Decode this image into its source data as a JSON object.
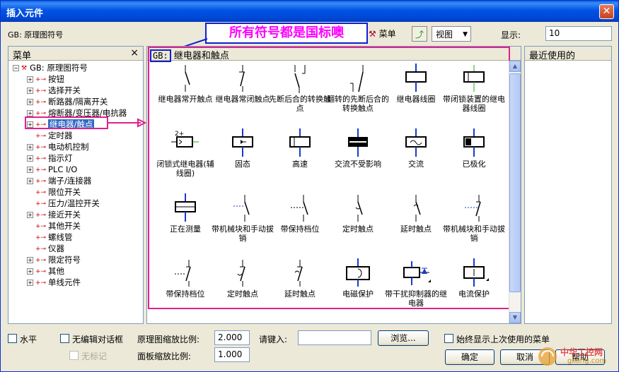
{
  "window": {
    "title": "插入元件",
    "close": "✕"
  },
  "top": {
    "library_label": "GB: 原理图符号",
    "annotation": "所有符号都是国标噢",
    "menu_button": "菜单",
    "view_button": "视图",
    "display_label": "显示:",
    "display_value": "10"
  },
  "left_panel": {
    "header": "菜单",
    "close": "×",
    "root": "GB: 原理图符号",
    "items": [
      {
        "label": "按钮",
        "expander": "+"
      },
      {
        "label": "选择开关",
        "expander": "+"
      },
      {
        "label": "断路器/隔离开关",
        "expander": "+"
      },
      {
        "label": "熔断器/变压器/电抗器",
        "expander": "+"
      },
      {
        "label": "继电器/触点",
        "expander": "+"
      },
      {
        "label": "定时器",
        "expander": ""
      },
      {
        "label": "电动机控制",
        "expander": "+"
      },
      {
        "label": "指示灯",
        "expander": "+"
      },
      {
        "label": "PLC I/O",
        "expander": "+"
      },
      {
        "label": "端子/连接器",
        "expander": "+"
      },
      {
        "label": "限位开关",
        "expander": ""
      },
      {
        "label": "压力/温控开关",
        "expander": ""
      },
      {
        "label": "接近开关",
        "expander": "+"
      },
      {
        "label": "其他开关",
        "expander": ""
      },
      {
        "label": "螺线管",
        "expander": ""
      },
      {
        "label": "仪器",
        "expander": ""
      },
      {
        "label": "限定符号",
        "expander": "+"
      },
      {
        "label": "其他",
        "expander": "+"
      },
      {
        "label": "单线元件",
        "expander": "+"
      }
    ],
    "selected_index": 4
  },
  "center_panel": {
    "header_prefix": "GB:",
    "header_title": "继电器和触点",
    "symbols": [
      {
        "label": "继电器常开触点",
        "icon": "no-contact-icon"
      },
      {
        "label": "继电器常闭触点",
        "icon": "nc-contact-icon"
      },
      {
        "label": "先断后合的转换触点",
        "icon": "break-before-make-icon"
      },
      {
        "label": "翻转的先断后合的转换触点",
        "icon": "flipped-changeover-icon"
      },
      {
        "label": "继电器线圈",
        "icon": "relay-coil-icon"
      },
      {
        "label": "带闭锁装置的继电器线圈",
        "icon": "latching-coil-icon"
      },
      {
        "label": "闭锁式继电器(辅线圈)",
        "icon": "latch-relay-icon",
        "tag": "2+"
      },
      {
        "label": "固态",
        "icon": "solid-state-icon"
      },
      {
        "label": "高速",
        "icon": "high-speed-icon"
      },
      {
        "label": "交流不受影响",
        "icon": "ac-immune-icon"
      },
      {
        "label": "交流",
        "icon": "ac-coil-icon"
      },
      {
        "label": "已极化",
        "icon": "polarized-icon"
      },
      {
        "label": "正在测量",
        "icon": "measuring-icon"
      },
      {
        "label": "带机械块和手动拔销",
        "icon": "mech-block-icon"
      },
      {
        "label": "带保持档位",
        "icon": "hold-position-icon"
      },
      {
        "label": "定时触点",
        "icon": "timed-contact-icon"
      },
      {
        "label": "延时触点",
        "icon": "delay-contact-icon"
      },
      {
        "label": "带机械块和手动拔销",
        "icon": "mech-block-nc-icon"
      },
      {
        "label": "带保持档位",
        "icon": "hold-position-nc-icon"
      },
      {
        "label": "定时触点",
        "icon": "timed-contact-nc-icon"
      },
      {
        "label": "延时触点",
        "icon": "delay-contact-nc-icon"
      },
      {
        "label": "电磁保护",
        "icon": "em-protection-icon"
      },
      {
        "label": "带干扰抑制器的继电器",
        "icon": "suppressor-relay-icon"
      },
      {
        "label": "电流保护",
        "icon": "current-protection-icon"
      }
    ]
  },
  "right_panel": {
    "header": "最近使用的"
  },
  "bottom": {
    "horizontal": "水平",
    "no_edit_dialog": "无编辑对话框",
    "no_tag": "无标记",
    "schematic_scale_label": "原理图缩放比例:",
    "schematic_scale_value": "2.000",
    "panel_scale_label": "面板缩放比例:",
    "panel_scale_value": "1.000",
    "enter_label": "请键入:",
    "browse": "浏览...",
    "always_show": "始终显示上次使用的菜单",
    "ok": "确定",
    "cancel": "取消",
    "help": "帮助"
  },
  "watermark": {
    "text": "中华工控网",
    "url": "gkong.com"
  },
  "colors": {
    "accent": "#e0208c",
    "annot_border": "#1020d0",
    "title_blue": "#0054e3",
    "selection": "#316ac5"
  }
}
